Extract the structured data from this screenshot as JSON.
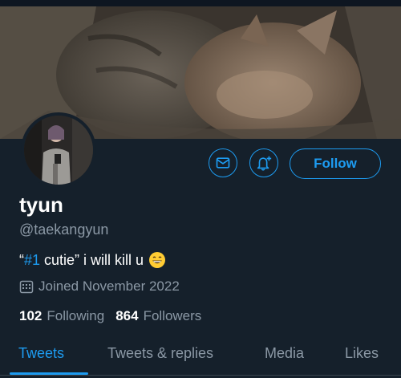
{
  "profile": {
    "name": "tyun",
    "handle": "@taekangyun",
    "bio_quote_open": "“",
    "bio_hash": "#1",
    "bio_rest": " cutie” i will kill u",
    "bio_emoji": "grinning-face-icon",
    "joined": "Joined November 2022",
    "following_count": "102",
    "following_label": "Following",
    "followers_count": "864",
    "followers_label": "Followers"
  },
  "actions": {
    "message_icon": "mail-icon",
    "notify_icon": "bell-plus-icon",
    "follow_label": "Follow"
  },
  "tabs": [
    {
      "label": "Tweets",
      "active": true
    },
    {
      "label": "Tweets & replies",
      "active": false
    },
    {
      "label": "Media",
      "active": false
    },
    {
      "label": "Likes",
      "active": false
    }
  ],
  "colors": {
    "background": "#15202b",
    "accent": "#1d9bf0",
    "secondary_text": "#8b98a5"
  }
}
